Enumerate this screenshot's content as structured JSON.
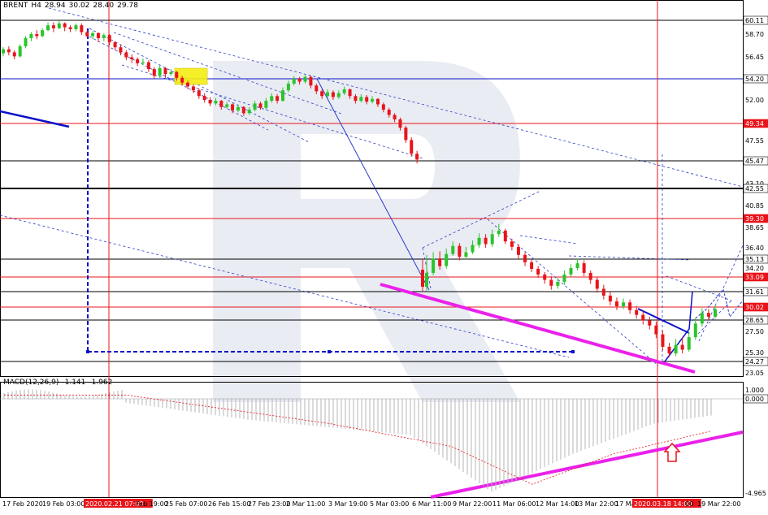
{
  "chart_data": [
    {
      "type": "candlestick",
      "symbol": "BRENT",
      "timeframe": "H4",
      "ohlc_header": [
        "28.94",
        "30.02",
        "28.40",
        "29.78"
      ],
      "ylim": [
        23.05,
        61.35
      ],
      "price_ticks": [
        "60.11",
        "58.70",
        "56.45",
        "54.20",
        "52.00",
        "49.34",
        "47.55",
        "45.47",
        "43.10",
        "42.55",
        "40.85",
        "39.30",
        "38.65",
        "36.40",
        "35.13",
        "34.20",
        "33.09",
        "31.61",
        "30.02",
        "28.65",
        "27.50",
        "25.30",
        "24.27",
        "23.05"
      ],
      "x_labels": [
        "17 Feb 2020",
        "19 Feb 03:00",
        "2020.02.21 07:00",
        "Feb 19:00",
        "25 Feb 07:00",
        "26 Feb 15:00",
        "27 Feb 23:00",
        "2 Mar 11:00",
        "3 Mar 19:00",
        "5 Mar 03:00",
        "6 Mar 11:00",
        "9 Mar 22:00",
        "11 Mar 06:00",
        "12 Mar 14:00",
        "13 Mar 22:00",
        "17 Ma",
        "2020.03.18 14:00",
        "00",
        "19 Mar 22:00"
      ],
      "horizontal_levels": [
        {
          "value": 60.11,
          "color": "#000000",
          "label": "60.11"
        },
        {
          "value": 54.2,
          "color": "#0a12c8",
          "label": "54.20"
        },
        {
          "value": 49.34,
          "color": "#e8141a",
          "label": "49.34"
        },
        {
          "value": 45.47,
          "color": "#000000",
          "label": "45.47"
        },
        {
          "value": 42.55,
          "color": "#000000",
          "label": "42.55"
        },
        {
          "value": 39.3,
          "color": "#e8141a",
          "label": "39.30"
        },
        {
          "value": 35.13,
          "color": "#000000",
          "label": "35.13"
        },
        {
          "value": 33.09,
          "color": "#e8141a",
          "label": "33.09"
        },
        {
          "value": 31.61,
          "color": "#000000",
          "label": "31.61"
        },
        {
          "value": 30.02,
          "color": "#e8141a",
          "label": "30.02"
        },
        {
          "value": 28.65,
          "color": "#000000",
          "label": "28.65"
        },
        {
          "value": 24.27,
          "color": "#000000",
          "label": "24.27"
        }
      ],
      "candles": [
        [
          56.8,
          57.2,
          57.4,
          56.5
        ],
        [
          57.2,
          56.9,
          57.5,
          56.6
        ],
        [
          56.9,
          56.5,
          57.1,
          56.2
        ],
        [
          56.5,
          57.5,
          57.7,
          56.4
        ],
        [
          57.5,
          58.3,
          58.5,
          57.3
        ],
        [
          58.3,
          58.7,
          58.9,
          58.0
        ],
        [
          58.7,
          58.5,
          59.1,
          58.2
        ],
        [
          58.5,
          59.1,
          59.3,
          58.4
        ],
        [
          59.1,
          59.6,
          59.9,
          59.0
        ],
        [
          59.6,
          59.3,
          59.9,
          58.9
        ],
        [
          59.3,
          59.8,
          60.1,
          59.2
        ],
        [
          59.8,
          59.4,
          59.9,
          59.0
        ],
        [
          59.4,
          59.2,
          59.6,
          58.9
        ],
        [
          59.2,
          59.6,
          59.8,
          59.0
        ],
        [
          59.6,
          58.9,
          59.8,
          58.6
        ],
        [
          58.9,
          58.5,
          59.1,
          58.3
        ],
        [
          58.5,
          58.8,
          59.0,
          58.2
        ],
        [
          58.8,
          58.3,
          58.9,
          57.9
        ],
        [
          58.3,
          58.6,
          58.8,
          58.0
        ],
        [
          58.6,
          57.9,
          58.7,
          57.6
        ],
        [
          57.9,
          57.4,
          58.0,
          57.1
        ],
        [
          57.4,
          56.9,
          57.6,
          56.6
        ],
        [
          56.9,
          56.4,
          57.1,
          56.1
        ],
        [
          56.4,
          56.2,
          56.7,
          55.8
        ],
        [
          56.2,
          55.8,
          56.4,
          55.5
        ],
        [
          55.8,
          55.9,
          56.3,
          55.6
        ],
        [
          55.9,
          55.2,
          56.1,
          54.9
        ],
        [
          55.2,
          54.5,
          55.4,
          54.2
        ],
        [
          54.5,
          55.3,
          55.6,
          54.3
        ],
        [
          55.3,
          54.7,
          55.4,
          54.3
        ],
        [
          54.7,
          54.9,
          55.2,
          54.5
        ],
        [
          54.9,
          54.3,
          55.0,
          54.0
        ],
        [
          54.3,
          53.8,
          54.5,
          53.5
        ],
        [
          53.8,
          53.4,
          54.0,
          53.1
        ],
        [
          53.4,
          53.0,
          53.6,
          52.7
        ],
        [
          53.0,
          52.4,
          53.2,
          52.1
        ],
        [
          52.4,
          52.0,
          52.7,
          51.7
        ],
        [
          52.0,
          51.6,
          52.3,
          51.3
        ],
        [
          51.6,
          51.9,
          52.2,
          51.4
        ],
        [
          51.9,
          51.2,
          52.0,
          50.9
        ],
        [
          51.2,
          51.5,
          51.8,
          51.0
        ],
        [
          51.5,
          50.8,
          51.6,
          50.5
        ],
        [
          50.8,
          51.2,
          51.5,
          50.6
        ],
        [
          51.2,
          50.5,
          51.3,
          50.2
        ],
        [
          50.5,
          50.9,
          51.2,
          50.3
        ],
        [
          50.9,
          51.6,
          51.9,
          50.7
        ],
        [
          51.6,
          51.1,
          51.8,
          50.9
        ],
        [
          51.1,
          51.9,
          52.2,
          50.9
        ],
        [
          51.9,
          52.4,
          52.7,
          51.7
        ],
        [
          52.4,
          51.9,
          52.6,
          51.6
        ],
        [
          51.9,
          53.0,
          53.3,
          51.8
        ],
        [
          53.0,
          53.7,
          54.0,
          52.8
        ],
        [
          53.7,
          54.2,
          54.5,
          53.5
        ],
        [
          54.2,
          53.9,
          54.4,
          53.6
        ],
        [
          53.9,
          54.4,
          54.6,
          53.7
        ],
        [
          54.4,
          53.5,
          54.5,
          53.2
        ],
        [
          53.5,
          52.9,
          53.7,
          52.6
        ],
        [
          52.9,
          52.4,
          53.1,
          52.1
        ],
        [
          52.4,
          52.8,
          53.1,
          52.2
        ],
        [
          52.8,
          52.3,
          53.0,
          52.0
        ],
        [
          52.3,
          52.7,
          53.0,
          52.1
        ],
        [
          52.7,
          53.1,
          53.4,
          52.5
        ],
        [
          53.1,
          52.4,
          53.2,
          52.1
        ],
        [
          52.4,
          51.9,
          52.6,
          51.6
        ],
        [
          51.9,
          52.3,
          52.6,
          51.7
        ],
        [
          52.3,
          51.8,
          52.5,
          51.5
        ],
        [
          51.8,
          52.1,
          52.4,
          51.6
        ],
        [
          52.1,
          51.5,
          52.2,
          51.2
        ],
        [
          51.5,
          50.9,
          51.7,
          50.6
        ],
        [
          50.9,
          50.3,
          51.1,
          50.0
        ],
        [
          50.3,
          49.8,
          50.5,
          49.5
        ],
        [
          49.8,
          48.9,
          50.0,
          48.6
        ],
        [
          48.9,
          47.6,
          49.1,
          47.3
        ],
        [
          47.6,
          46.2,
          47.9,
          45.9
        ],
        [
          46.2,
          45.6,
          46.5,
          45.2
        ],
        [
          34.0,
          32.1,
          35.2,
          31.6
        ],
        [
          32.1,
          33.6,
          35.6,
          31.7
        ],
        [
          33.6,
          35.2,
          35.9,
          33.3
        ],
        [
          35.2,
          34.4,
          36.0,
          34.0
        ],
        [
          34.4,
          35.7,
          36.3,
          34.1
        ],
        [
          35.7,
          36.6,
          37.1,
          35.5
        ],
        [
          36.6,
          35.4,
          36.9,
          35.0
        ],
        [
          35.4,
          35.9,
          36.5,
          35.1
        ],
        [
          35.9,
          36.7,
          37.2,
          35.7
        ],
        [
          36.7,
          37.5,
          38.0,
          36.4
        ],
        [
          37.5,
          36.8,
          37.9,
          36.4
        ],
        [
          36.8,
          37.9,
          38.4,
          36.5
        ],
        [
          37.9,
          38.3,
          38.9,
          37.6
        ],
        [
          38.3,
          37.1,
          38.5,
          36.8
        ],
        [
          37.1,
          36.5,
          37.4,
          36.1
        ],
        [
          36.5,
          35.6,
          36.8,
          35.2
        ],
        [
          35.6,
          34.8,
          35.9,
          34.4
        ],
        [
          34.8,
          34.1,
          35.1,
          33.7
        ],
        [
          34.1,
          33.4,
          34.4,
          33.0
        ],
        [
          33.4,
          32.8,
          33.7,
          32.4
        ],
        [
          32.8,
          32.2,
          33.2,
          31.8
        ],
        [
          32.2,
          32.6,
          33.0,
          31.9
        ],
        [
          32.6,
          33.4,
          33.9,
          32.3
        ],
        [
          33.4,
          34.2,
          34.6,
          33.1
        ],
        [
          34.2,
          34.7,
          35.2,
          33.9
        ],
        [
          34.7,
          33.6,
          35.0,
          33.2
        ],
        [
          33.6,
          32.8,
          33.9,
          32.4
        ],
        [
          32.8,
          31.9,
          33.1,
          31.5
        ],
        [
          31.9,
          31.2,
          32.3,
          30.8
        ],
        [
          31.2,
          30.6,
          31.6,
          30.2
        ],
        [
          30.6,
          30.1,
          31.0,
          29.7
        ],
        [
          30.1,
          30.5,
          30.9,
          29.8
        ],
        [
          30.5,
          29.7,
          30.8,
          29.3
        ],
        [
          29.7,
          29.2,
          30.1,
          28.8
        ],
        [
          29.2,
          28.6,
          29.6,
          28.2
        ],
        [
          28.6,
          28.1,
          29.0,
          27.7
        ],
        [
          28.1,
          27.2,
          28.5,
          26.8
        ],
        [
          27.2,
          25.9,
          27.6,
          25.5
        ],
        [
          25.9,
          25.2,
          26.3,
          24.8
        ],
        [
          25.2,
          26.1,
          26.7,
          24.9
        ],
        [
          26.1,
          25.6,
          26.9,
          25.2
        ],
        [
          25.6,
          26.9,
          27.5,
          25.4
        ],
        [
          26.9,
          28.3,
          28.9,
          26.6
        ],
        [
          28.3,
          29.4,
          29.9,
          28.0
        ],
        [
          29.4,
          29.0,
          29.8,
          28.6
        ],
        [
          29.0,
          29.8,
          30.2,
          28.8
        ]
      ]
    },
    {
      "type": "histogram",
      "indicator": "MACD(12,26,9)",
      "header_values": [
        "-1.141",
        "-1.962"
      ],
      "ylim": [
        -4.965,
        1.0
      ],
      "ticks": [
        "1.000",
        "0.000",
        "-4.965"
      ]
    }
  ]
}
